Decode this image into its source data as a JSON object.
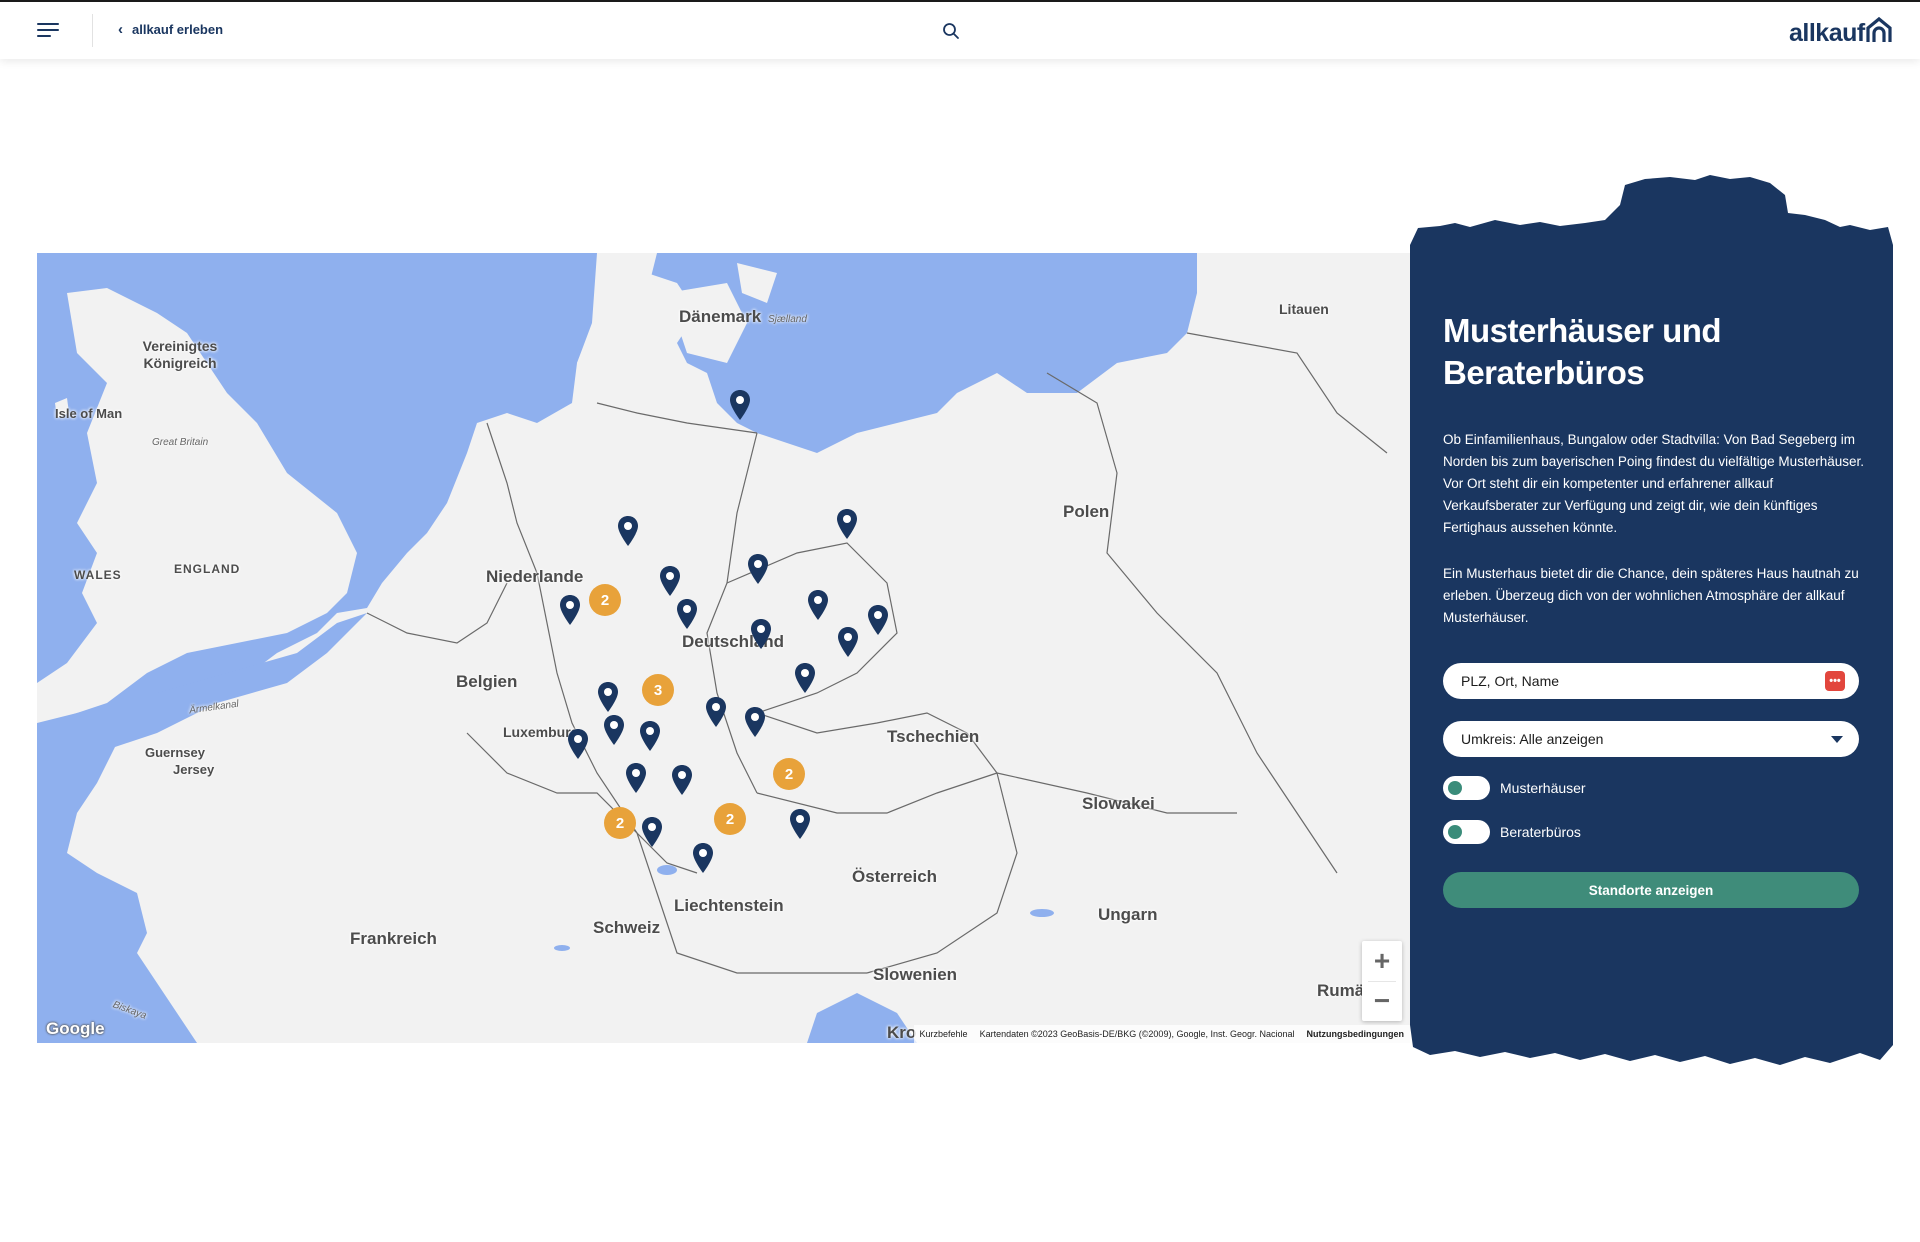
{
  "header": {
    "back_label": "allkauf erleben",
    "logo_text": "allkauf"
  },
  "map": {
    "countries": [
      {
        "key": "daenemark",
        "label": "Dänemark"
      },
      {
        "key": "sjaelland",
        "label": "Sjælland"
      },
      {
        "key": "litauen",
        "label": "Litauen"
      },
      {
        "key": "vk",
        "label": "Vereinigtes Königreich"
      },
      {
        "key": "isle",
        "label": "Isle of Man"
      },
      {
        "key": "gb",
        "label": "Great Britain"
      },
      {
        "key": "polen",
        "label": "Polen"
      },
      {
        "key": "wales",
        "label": "WALES"
      },
      {
        "key": "england",
        "label": "ENGLAND"
      },
      {
        "key": "niederlande",
        "label": "Niederlande"
      },
      {
        "key": "deutschland",
        "label": "Deutschland"
      },
      {
        "key": "belgien",
        "label": "Belgien"
      },
      {
        "key": "aermelkanal",
        "label": "Ärmelkanal"
      },
      {
        "key": "luxemburg",
        "label": "Luxemburg"
      },
      {
        "key": "tschechien",
        "label": "Tschechien"
      },
      {
        "key": "guernsey",
        "label": "Guernsey"
      },
      {
        "key": "jersey",
        "label": "Jersey"
      },
      {
        "key": "slowakei",
        "label": "Slowakei"
      },
      {
        "key": "oesterreich",
        "label": "Österreich"
      },
      {
        "key": "liechtenstein",
        "label": "Liechtenstein"
      },
      {
        "key": "ungarn",
        "label": "Ungarn"
      },
      {
        "key": "schweiz",
        "label": "Schweiz"
      },
      {
        "key": "frankreich",
        "label": "Frankreich"
      },
      {
        "key": "slowenien",
        "label": "Slowenien"
      },
      {
        "key": "rumaenien",
        "label": "Rumä"
      },
      {
        "key": "biskaya",
        "label": "Biskaya"
      },
      {
        "key": "kro",
        "label": "Kro"
      }
    ],
    "clusters": [
      "2",
      "3",
      "2",
      "2",
      "2"
    ],
    "zoom_in": "+",
    "zoom_out": "−",
    "google_label": "Google",
    "attribution": {
      "shortcuts": "Kurzbefehle",
      "data": "Kartendaten ©2023 GeoBasis-DE/BKG (©2009), Google, Inst. Geogr. Nacional",
      "terms": "Nutzungsbedingungen"
    },
    "colors": {
      "water": "#8fb0ee",
      "land": "#f2f2f2",
      "pin": "#1a3660",
      "cluster": "#e8a23a"
    }
  },
  "panel": {
    "title": "Musterhäuser und Beraterbüros",
    "paragraph1": "Ob Einfamilienhaus, Bungalow oder Stadtvilla: Von Bad Segeberg im Norden bis zum bayerischen Poing findest du vielfältige Musterhäuser. Vor Ort steht dir ein kompetenter und erfahrener allkauf Verkaufsberater zur Verfügung und zeigt dir, wie dein künftiges Fertighaus aussehen könnte.",
    "paragraph2": "Ein Musterhaus bietet dir die Chance, dein späteres Haus hautnah zu erleben. Überzeug dich von der wohnlichen Atmosphäre der allkauf Musterhäuser.",
    "search_placeholder": "PLZ, Ort, Name",
    "radius_select": "Umkreis: Alle anzeigen",
    "toggle1_label": "Musterhäuser",
    "toggle2_label": "Beraterbüros",
    "submit_label": "Standorte anzeigen",
    "colors": {
      "background": "#1a3660",
      "button": "#3f8c7a"
    }
  }
}
